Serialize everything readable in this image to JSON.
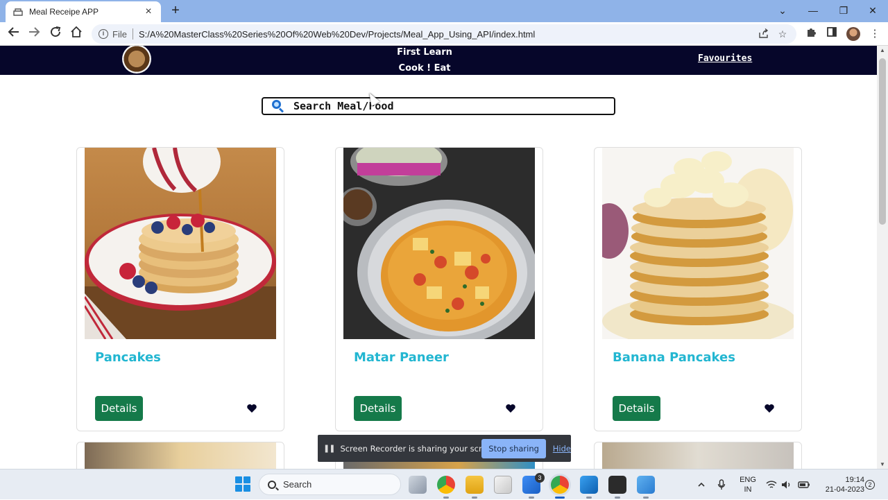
{
  "browser": {
    "tab_title": "Meal Receipe APP",
    "tab_close": "×",
    "new_tab": "+",
    "file_label": "File",
    "url": "S:/A%20MasterClass%20Series%20Of%20Web%20Dev/Projects/Meal_App_Using_API/index.html",
    "window_controls": {
      "collapse": "⌄",
      "minimize": "—",
      "maximize": "❐",
      "close": "✕"
    }
  },
  "site": {
    "tagline_line1": "First Learn",
    "tagline_line2": "Cook ! Eat",
    "favourites_link": "Favourites",
    "search_placeholder": "Search Meal/Food"
  },
  "meals": [
    {
      "name": "Pancakes",
      "button": "Details"
    },
    {
      "name": "Matar Paneer",
      "button": "Details"
    },
    {
      "name": "Banana Pancakes",
      "button": "Details"
    }
  ],
  "screen_share": {
    "message": "Screen Recorder is sharing your screen.",
    "stop_button": "Stop sharing",
    "hide_link": "Hide"
  },
  "taskbar": {
    "search_label": "Search",
    "todo_badge": "3",
    "lang_line1": "ENG",
    "lang_line2": "IN",
    "time": "19:14",
    "date": "21-04-2023",
    "notifications": "2"
  },
  "colors": {
    "header_bg": "#06062a",
    "card_title": "#22b6d1",
    "details_button": "#157a4a",
    "tabstrip": "#8fb3e8"
  }
}
